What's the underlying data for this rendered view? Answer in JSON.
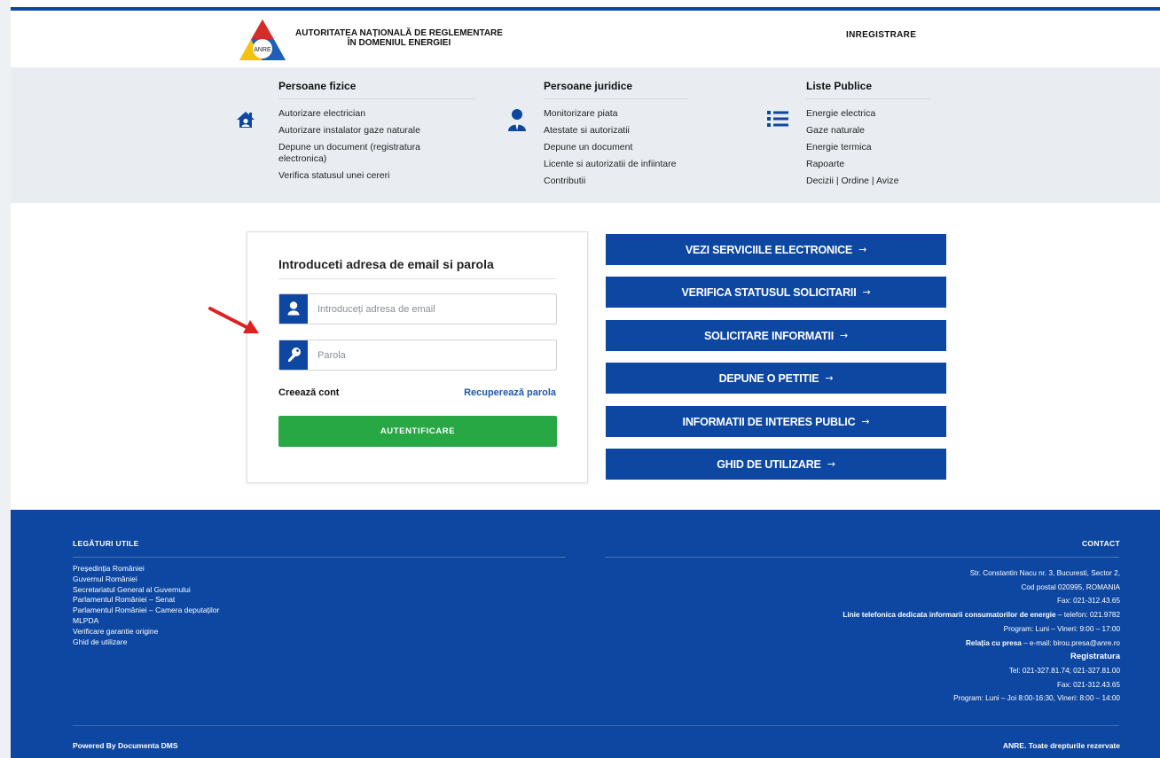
{
  "header": {
    "org_name_line1": "AUTORITATEA NAȚIONALĂ DE REGLEMENTARE",
    "org_name_line2": "ÎN DOMENIUL ENERGIEI",
    "logo_text": "ANRE",
    "register_label": "INREGISTRARE"
  },
  "nav": {
    "persons": {
      "title": "Persoane fizice",
      "icon": "home-icon",
      "items": [
        "Autorizare electrician",
        "Autorizare instalator gaze naturale",
        "Depune un document (registratura electronica)",
        "Verifica statusul unei cereri"
      ]
    },
    "companies": {
      "title": "Persoane juridice",
      "icon": "business-person-icon",
      "items": [
        "Monitorizare piata",
        "Atestate si autorizatii",
        "Depune un document",
        "Licente si autorizatii de infiintare",
        "Contributii"
      ]
    },
    "public_lists": {
      "title": "Liste Publice",
      "icon": "list-icon",
      "items": [
        "Energie electrica",
        "Gaze naturale",
        "Energie termica",
        "Rapoarte",
        "Decizii | Ordine | Avize"
      ]
    }
  },
  "login": {
    "title": "Introduceti adresa de email si parola",
    "email_placeholder": "Introduceți adresa de email",
    "email_value": "",
    "password_placeholder": "Parola",
    "password_value": "",
    "create_account": "Creează cont",
    "recover_password": "Recuperează parola",
    "submit": "AUTENTIFICARE"
  },
  "actions": [
    {
      "label": "VEZI SERVICIILE ELECTRONICE",
      "arrow": "→"
    },
    {
      "label": "VERIFICA STATUSUL SOLICITARII",
      "arrow": "→"
    },
    {
      "label": "SOLICITARE INFORMATII",
      "arrow": "→"
    },
    {
      "label": "DEPUNE O PETITIE",
      "arrow": "→"
    },
    {
      "label": "INFORMATII DE INTERES PUBLIC",
      "arrow": "→"
    },
    {
      "label": "GHID DE UTILIZARE",
      "arrow": "→"
    }
  ],
  "footer": {
    "links_title": "LEGĂTURI UTILE",
    "links": [
      "Președinția României",
      "Guvernul României",
      "Secretariatul General al Guvernului",
      "Parlamentul României – Senat",
      "Parlamentul României – Camera deputaților",
      "MLPDA",
      "Verificare garantie origine",
      "Ghid de utilizare"
    ],
    "contact_title": "CONTACT",
    "address": "Str. Constantin Nacu nr. 3, Bucuresti, Sector 2,",
    "postal": "Cod postal 020995, ROMANIA",
    "fax1": "Fax: 021-312.43.65",
    "hotline_bold": "Linie telefonica dedicata informarii consumatorilor de energie",
    "hotline_rest": " – telefon: 021.9782",
    "program1": "Program: Luni – Vineri: 9:00 – 17:00",
    "press_bold": "Relația cu presa",
    "press_rest": " – e-mail: birou.presa@anre.ro",
    "registry_title": "Registratura",
    "registry_tel": "Tel: 021-327.81.74; 021-327.81.00",
    "registry_fax": "Fax: 021-312.43.65",
    "registry_program": "Program: Luni – Joi 8:00-16:30, Vineri: 8:00 – 14:00",
    "powered_by": "Powered By Documenta DMS",
    "rights": "ANRE. Toate drepturile rezervate"
  },
  "colors": {
    "primary_blue": "#0d47a1",
    "login_green": "#28a745",
    "annotation_red": "#e02020",
    "nav_bg": "#e9edf2"
  }
}
